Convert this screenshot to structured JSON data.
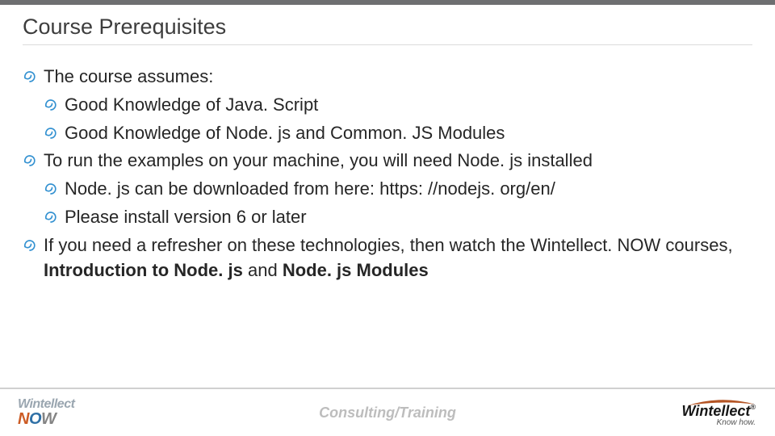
{
  "header": {
    "title": "Course Prerequisites"
  },
  "bullets": {
    "a": "The course assumes:",
    "a1": "Good Knowledge of Java. Script",
    "a2": "Good Knowledge of Node. js and Common. JS Modules",
    "b": "To run the examples on your machine, you will need Node. js installed",
    "b1": "Node. js can be downloaded from here: https: //nodejs. org/en/",
    "b2": "Please install version 6 or later",
    "c_pre": "If you need a refresher on these technologies, then watch the Wintellect. NOW courses, ",
    "c_bold1": "Introduction to Node. js",
    "c_mid": " and ",
    "c_bold2": "Node. js Modules"
  },
  "footer": {
    "center": "Consulting/Training",
    "left_top": "Wintellect",
    "left_n": "N",
    "left_o": "O",
    "left_w": "W",
    "right_name": "Wintellect",
    "right_tag": "Know how."
  },
  "colors": {
    "accent_blue": "#3391d1",
    "topbar": "#6e6f71"
  }
}
